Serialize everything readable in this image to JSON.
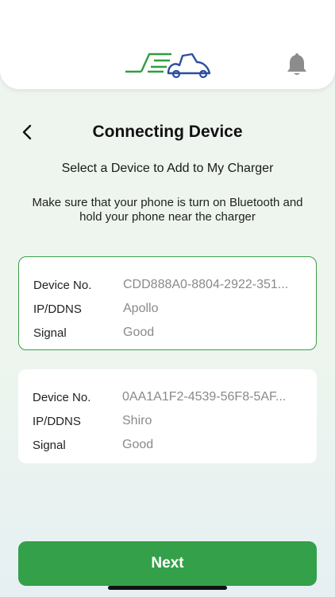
{
  "header": {
    "logo_icon": "charger-scooter-logo-icon",
    "notification_icon": "bell-icon"
  },
  "nav": {
    "back_icon": "chevron-left-icon",
    "title": "Connecting Device"
  },
  "subtitle": "Select a Device to Add to My Charger",
  "description": "Make sure that your phone is turn on Bluetooth and hold your phone near the charger",
  "devices": [
    {
      "selected": true,
      "device_no_label": "Device No.",
      "device_no": "CDD888A0-8804-2922-351...",
      "ip_label": "IP/DDNS",
      "ip": "Apollo",
      "signal_label": "Signal",
      "signal": "Good"
    },
    {
      "selected": false,
      "device_no_label": "Device No.",
      "device_no": "0AA1A1F2-4539-56F8-5AF...",
      "ip_label": "IP/DDNS",
      "ip": "Shiro",
      "signal_label": "Signal",
      "signal": "Good"
    }
  ],
  "next_button": "Next",
  "colors": {
    "accent_green": "#34a04a",
    "selected_border": "#3c9e46",
    "logo_blue": "#2a4fa0"
  }
}
